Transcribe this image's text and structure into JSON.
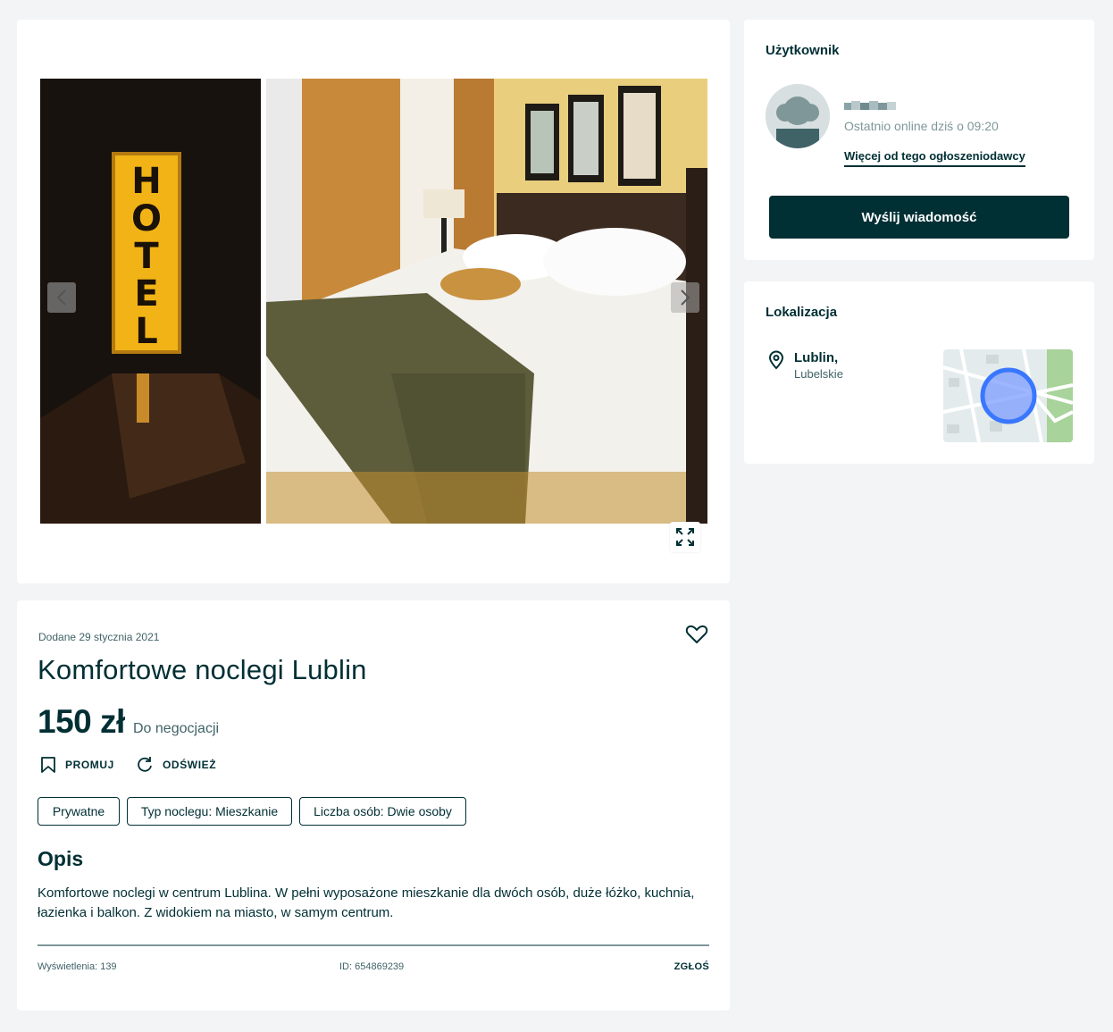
{
  "gallery": {
    "images": [
      {
        "alt": "hotel-sign-photo"
      },
      {
        "alt": "hotel-room-bed-photo"
      }
    ]
  },
  "listing": {
    "date": "Dodane 29 stycznia 2021",
    "title": "Komfortowe noclegi Lublin",
    "price": "150 zł",
    "negotiable": "Do negocjacji",
    "promote_label": "PROMUJ",
    "refresh_label": "ODŚWIEŻ",
    "tags": [
      "Prywatne",
      "Typ noclegu: Mieszkanie",
      "Liczba osób: Dwie osoby"
    ],
    "description_heading": "Opis",
    "description": "Komfortowe noclegi w centrum Lublina. W pełni wyposażone mieszkanie dla dwóch osób, duże łóżko, kuchnia, łazienka i balkon. Z widokiem na miasto, w samym centrum.",
    "views": "Wyświetlenia: 139",
    "ad_id": "ID: 654869239",
    "report_label": "ZGŁOŚ"
  },
  "user": {
    "heading": "Użytkownik",
    "last_online": "Ostatnio online dziś o 09:20",
    "more_link": "Więcej od tego ogłoszeniodawcy",
    "send_button": "Wyślij wiadomość"
  },
  "location": {
    "heading": "Lokalizacja",
    "city": "Lublin,",
    "region": "Lubelskie"
  },
  "colors": {
    "primary": "#002f34",
    "background": "#f2f4f5",
    "muted": "#406367",
    "map_marker": "#3a77ff"
  }
}
